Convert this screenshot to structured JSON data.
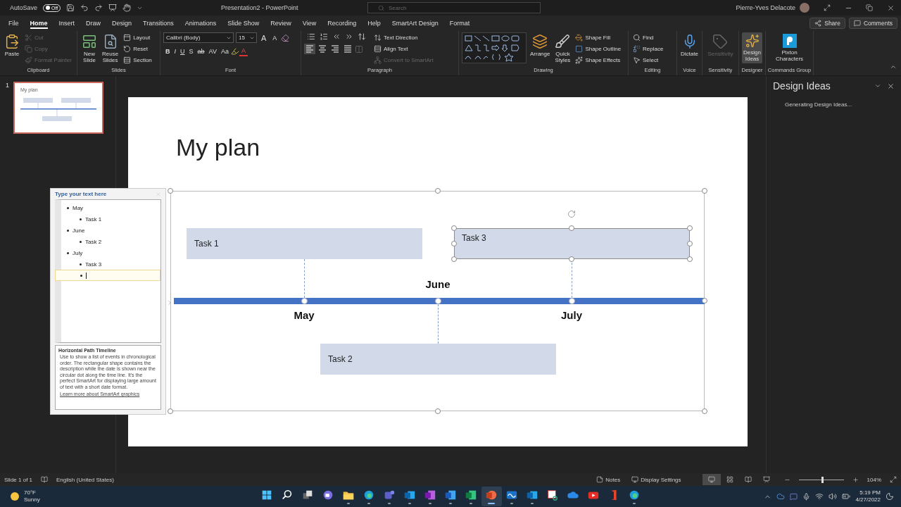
{
  "title_bar": {
    "autosave": {
      "label": "AutoSave",
      "on": false,
      "state_label": "Off"
    },
    "title": "Presentation2 - PowerPoint",
    "search": {
      "placeholder": "Search"
    },
    "user_name": "Pierre-Yves Delacote"
  },
  "menu_tabs": [
    {
      "label": "File",
      "selected": false
    },
    {
      "label": "Home",
      "selected": true
    },
    {
      "label": "Insert",
      "selected": false
    },
    {
      "label": "Draw",
      "selected": false
    },
    {
      "label": "Design",
      "selected": false
    },
    {
      "label": "Transitions",
      "selected": false
    },
    {
      "label": "Animations",
      "selected": false
    },
    {
      "label": "Slide Show",
      "selected": false
    },
    {
      "label": "Review",
      "selected": false
    },
    {
      "label": "View",
      "selected": false
    },
    {
      "label": "Recording",
      "selected": false
    },
    {
      "label": "Help",
      "selected": false
    },
    {
      "label": "SmartArt Design",
      "selected": false
    },
    {
      "label": "Format",
      "selected": false
    }
  ],
  "share_button": "Share",
  "comments_button": "Comments",
  "ribbon": {
    "clipboard": {
      "label": "Clipboard",
      "paste": "Paste",
      "cut": {
        "label": "Cut",
        "disabled": true
      },
      "copy": {
        "label": "Copy",
        "disabled": true
      },
      "format_painter": {
        "label": "Format Painter",
        "disabled": true
      }
    },
    "slides": {
      "label": "Slides",
      "new_slide": [
        "New",
        "Slide"
      ],
      "reuse_slides": [
        "Reuse",
        "Slides"
      ],
      "layout": "Layout",
      "reset": "Reset",
      "section": "Section"
    },
    "font": {
      "label": "Font",
      "font_name": "Calibri (Body)",
      "font_size": "15",
      "grow_font": "A",
      "shrink_font": "A",
      "format_buttons": [
        "B",
        "I",
        "U",
        "S",
        "ab",
        "AV",
        "Aa"
      ],
      "font_color": "A"
    },
    "paragraph": {
      "label": "Paragraph",
      "alignment_buttons": [
        {
          "selected": true
        },
        {
          "selected": false
        },
        {
          "selected": false
        },
        {
          "selected": false
        }
      ],
      "text_direction": "Text Direction",
      "align_text": "Align Text",
      "convert": {
        "label": "Convert to SmartArt",
        "disabled": true
      }
    },
    "drawing": {
      "label": "Drawing",
      "arrange": [
        "Arrange"
      ],
      "quick_styles": [
        "Quick",
        "Styles"
      ],
      "shape_fill": "Shape Fill",
      "shape_outline": "Shape Outline",
      "shape_effects": "Shape Effects"
    },
    "editing": {
      "label": "Editing",
      "find": "Find",
      "replace": "Replace",
      "select": "Select"
    },
    "voice": {
      "label": "Voice",
      "dictate": [
        "Dictate"
      ]
    },
    "sensitivity": {
      "label": "Sensitivity",
      "button": {
        "lines": [
          "Sensitivity"
        ],
        "disabled": true
      }
    },
    "designer": {
      "label": "Designer",
      "design_ideas": {
        "lines": [
          "Design",
          "Ideas"
        ],
        "selected": true
      }
    },
    "commands": {
      "label": "Commands Group",
      "pixton": [
        "Pixton",
        "Characters"
      ]
    }
  },
  "slides_panel": {
    "slide_number": "1",
    "thumbnail": {
      "title": "My plan",
      "selected": true
    }
  },
  "slide": {
    "title": "My plan",
    "timeline": [
      {
        "date": "May",
        "task": "Task 1",
        "kind": "upper",
        "selected": false
      },
      {
        "date": "June",
        "task": "Task 2",
        "kind": "lower",
        "selected": false
      },
      {
        "date": "July",
        "task": "Task 3",
        "kind": "upper",
        "selected": true
      }
    ]
  },
  "text_pane": {
    "title": "Type your text here",
    "items": [
      {
        "text": "May",
        "children": [
          {
            "text": "Task 1",
            "current": false
          }
        ]
      },
      {
        "text": "June",
        "children": [
          {
            "text": "Task 2",
            "current": false
          }
        ]
      },
      {
        "text": "July",
        "children": [
          {
            "text": "Task 3",
            "current": false
          },
          {
            "current": true
          }
        ]
      }
    ],
    "description": {
      "title": "Horizontal Path Timeline",
      "text": "Use to show a list of events in chronological order. The rectangular shape contains the description while the date is shown near the circular dot along the time line. It's the perfect SmartArt for displaying large amount of text with a short date format.",
      "link": "Learn more about SmartArt graphics"
    }
  },
  "design_pane": {
    "title": "Design Ideas",
    "status": "Generating Design Ideas..."
  },
  "status_bar": {
    "slide": "Slide 1 of 1",
    "language": "English (United States)",
    "notes": "Notes",
    "display_settings": "Display Settings",
    "views": [
      {
        "selected": true
      },
      {
        "selected": false
      },
      {
        "selected": false
      },
      {
        "selected": false
      }
    ],
    "zoom": {
      "level": 0.53,
      "reading": "104%"
    }
  },
  "taskbar": {
    "weather": {
      "temperature": "70°F",
      "condition": "Sunny"
    },
    "apps": [
      {
        "kind": "start",
        "selected": false,
        "running": false
      },
      {
        "kind": "search",
        "selected": false,
        "running": false
      },
      {
        "kind": "taskview",
        "selected": false,
        "running": false
      },
      {
        "kind": "chat",
        "selected": false,
        "running": false
      },
      {
        "kind": "folder",
        "selected": false,
        "running": true
      },
      {
        "kind": "browser",
        "selected": false,
        "running": true
      },
      {
        "kind": "teams",
        "selected": false,
        "running": true
      },
      {
        "kind": "mail",
        "selected": false,
        "running": true
      },
      {
        "kind": "notebook",
        "selected": false,
        "running": true
      },
      {
        "kind": "document",
        "selected": false,
        "running": true
      },
      {
        "kind": "spreadsheet",
        "selected": false,
        "running": true
      },
      {
        "kind": "slides",
        "selected": true,
        "running": true
      },
      {
        "kind": "whiteboard",
        "selected": false,
        "running": true
      },
      {
        "kind": "mail",
        "selected": false,
        "running": true
      },
      {
        "kind": "snip",
        "selected": false,
        "running": false
      },
      {
        "kind": "cloud",
        "selected": false,
        "running": false
      },
      {
        "kind": "video",
        "selected": false,
        "running": false
      },
      {
        "kind": "office",
        "selected": false,
        "running": false
      },
      {
        "kind": "browser",
        "selected": false,
        "running": true
      }
    ],
    "clock": {
      "time": "5:19 PM",
      "date": "4/27/2022"
    }
  }
}
